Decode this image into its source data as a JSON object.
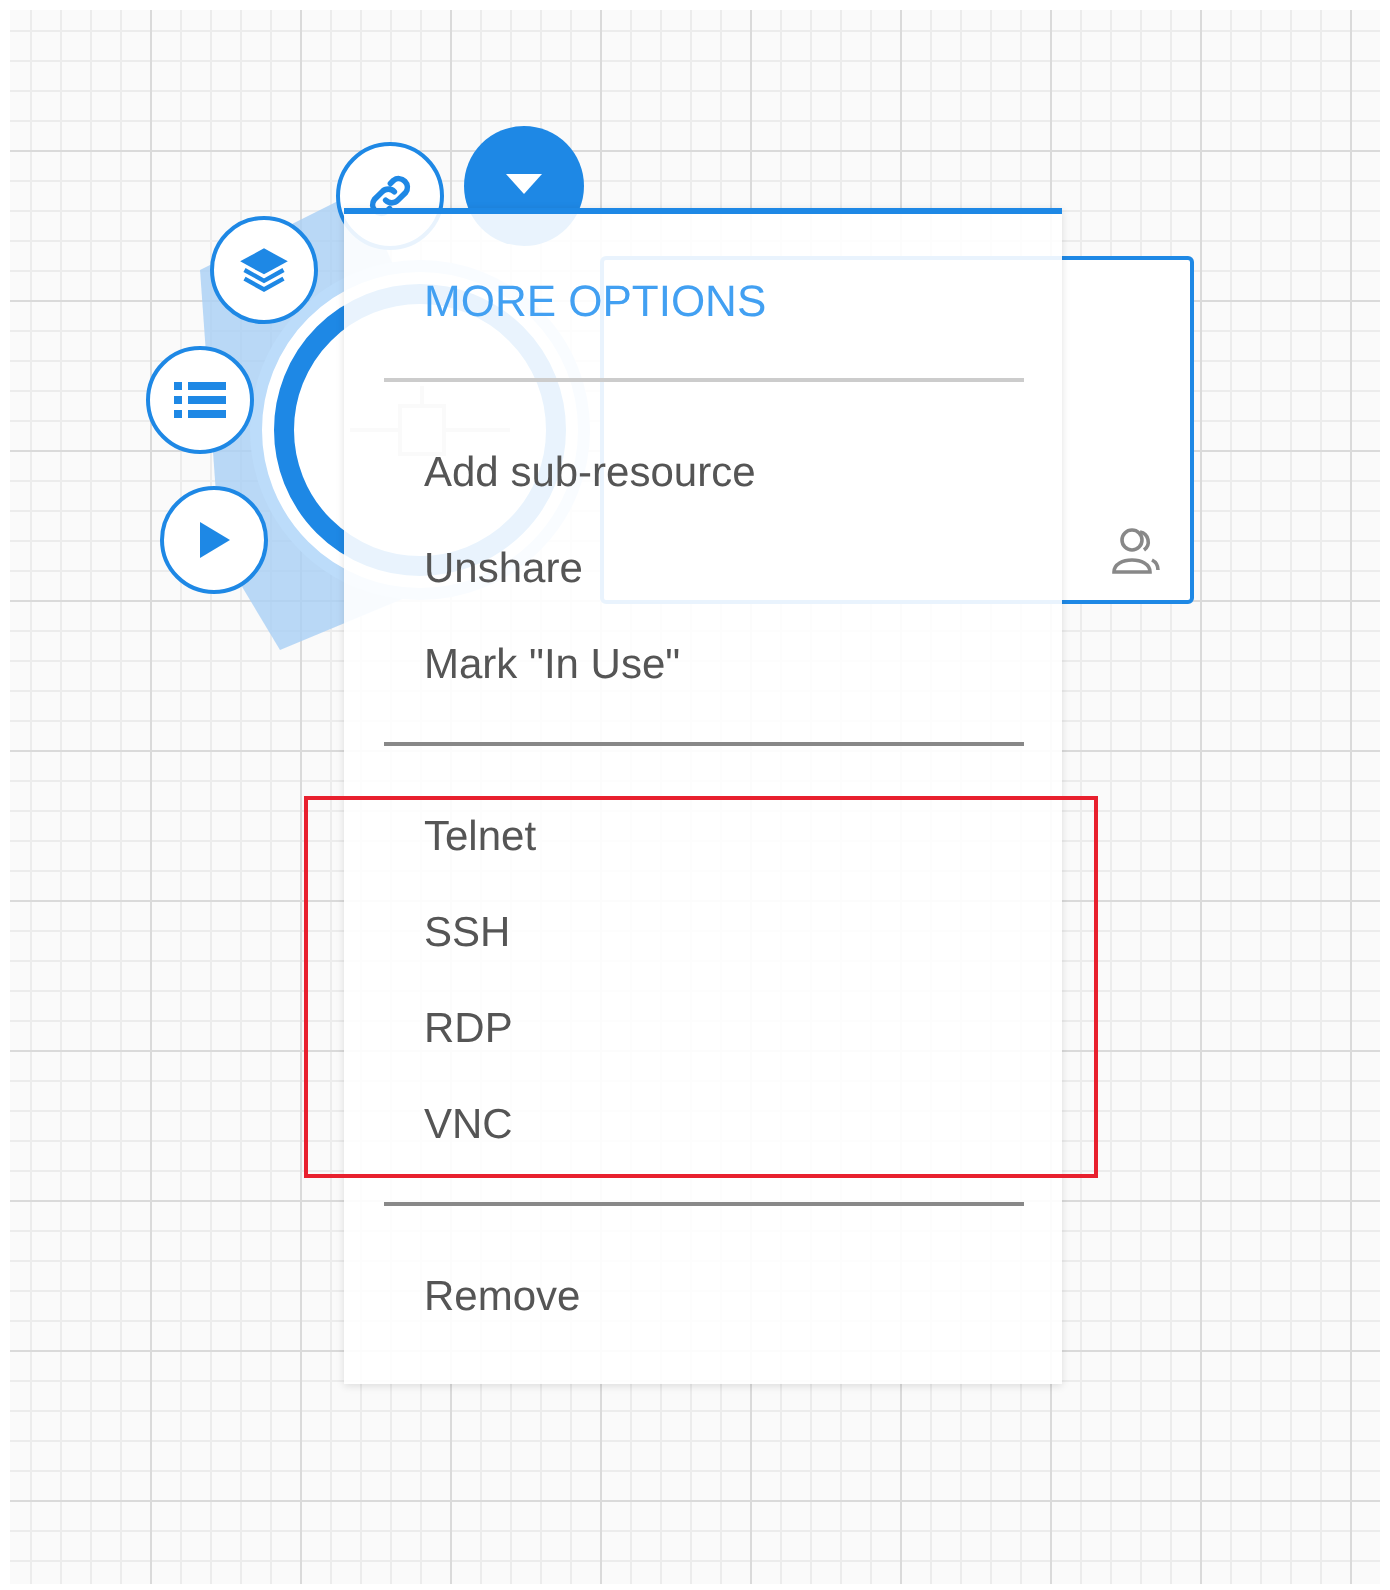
{
  "node_actions": [
    {
      "kind": "link"
    },
    {
      "kind": "layers"
    },
    {
      "kind": "list"
    },
    {
      "kind": "play"
    }
  ],
  "menu": {
    "title": "MORE OPTIONS",
    "sections": [
      {
        "highlighted": false,
        "items": [
          {
            "label": "Add sub-resource"
          },
          {
            "label": "Unshare"
          },
          {
            "label": "Mark \"In Use\""
          }
        ]
      },
      {
        "highlighted": true,
        "items": [
          {
            "label": "Telnet"
          },
          {
            "label": "SSH"
          },
          {
            "label": "RDP"
          },
          {
            "label": "VNC"
          }
        ]
      },
      {
        "highlighted": false,
        "items": [
          {
            "label": "Remove"
          }
        ]
      }
    ]
  }
}
